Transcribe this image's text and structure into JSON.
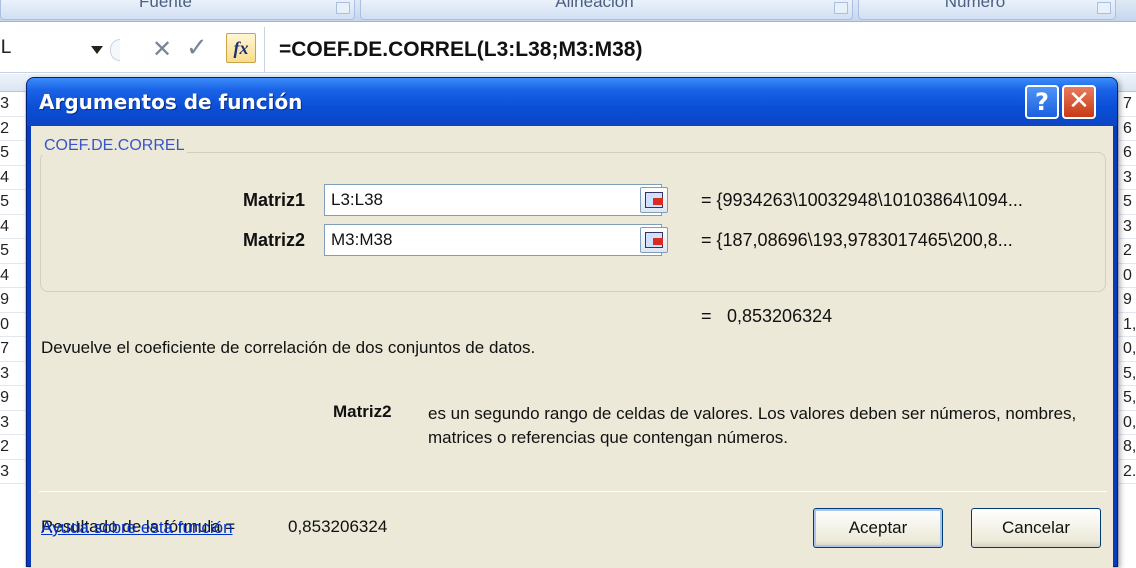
{
  "ribbon": {
    "groups": [
      {
        "label": "Fuente"
      },
      {
        "label": "Alineación"
      },
      {
        "label": "Número"
      }
    ]
  },
  "formula_bar": {
    "name_box": "L",
    "formula": "=COEF.DE.CORREL(L3:L38;M3:M38)",
    "fx_label": "fx"
  },
  "sheet": {
    "left_column_values": [
      "3",
      "2",
      "5",
      "4",
      "5",
      "4",
      "5",
      "4",
      "9",
      "0",
      "7",
      "3",
      "9",
      "3",
      "2",
      "3"
    ],
    "right_column_values": [
      "7",
      "6",
      "6",
      "3",
      "5",
      "3",
      "2",
      "0",
      "9",
      "1,",
      "0,",
      "5,",
      "5,",
      "0,",
      "8,",
      "2."
    ]
  },
  "dialog": {
    "title": "Argumentos de función",
    "help_button": "?",
    "close_button": "✕",
    "function_name": "COEF.DE.CORREL",
    "args": [
      {
        "label": "Matriz1",
        "value": "L3:L38",
        "preview": "= {9934263\\10032948\\10103864\\1094..."
      },
      {
        "label": "Matriz2",
        "value": "M3:M38",
        "preview": "= {187,08696\\193,9783017465\\200,8..."
      }
    ],
    "result_eq": "=",
    "result_value": "0,853206324",
    "description": "Devuelve el coeficiente de correlación de dos conjuntos de datos.",
    "arg_help_label": "Matriz2",
    "arg_help_text": "es un segundo rango de celdas de valores. Los valores deben ser números, nombres, matrices o referencias que contengan números.",
    "formula_result_label": "Resultado de la fórmula =",
    "formula_result_value": "0,853206324",
    "help_link": "Ayuda sobre esta función",
    "ok_button": "Aceptar",
    "cancel_button": "Cancelar"
  }
}
